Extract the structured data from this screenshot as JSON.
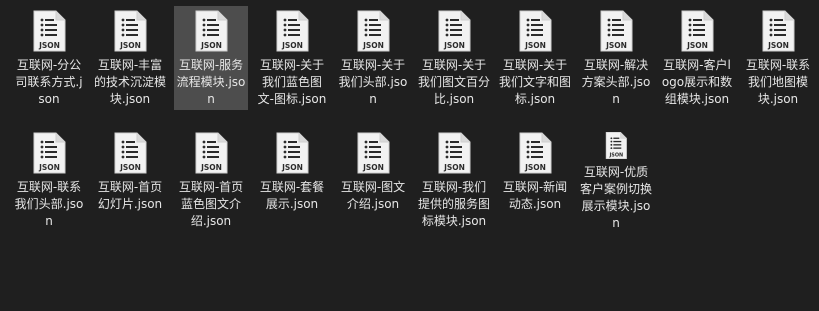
{
  "icon_badge": "JSON",
  "colors": {
    "background": "#1f1f1f",
    "selected": "#4d4d4d",
    "text": "#e6e6e6",
    "icon_body": "#f2f2f2",
    "icon_lines": "#2b2b2b"
  },
  "files": [
    {
      "name": "互联网-分公司联系方式.json",
      "selected": false
    },
    {
      "name": "互联网-丰富的技术沉淀模块.json",
      "selected": false
    },
    {
      "name": "互联网-服务流程模块.json",
      "selected": true
    },
    {
      "name": "互联网-关于我们蓝色图文-图标.json",
      "selected": false
    },
    {
      "name": "互联网-关于我们头部.json",
      "selected": false
    },
    {
      "name": "互联网-关于我们图文百分比.json",
      "selected": false
    },
    {
      "name": "互联网-关于我们文字和图标.json",
      "selected": false
    },
    {
      "name": "互联网-解决方案头部.json",
      "selected": false
    },
    {
      "name": "互联网-客户logo展示和数组模块.json",
      "selected": false
    },
    {
      "name": "互联网-联系我们地图模块.json",
      "selected": false
    },
    {
      "name": "互联网-联系我们头部.json",
      "selected": false
    },
    {
      "name": "互联网-首页幻灯片.json",
      "selected": false
    },
    {
      "name": "互联网-首页蓝色图文介绍.json",
      "selected": false
    },
    {
      "name": "互联网-套餐展示.json",
      "selected": false
    },
    {
      "name": "互联网-图文介绍.json",
      "selected": false
    },
    {
      "name": "互联网-我们提供的服务图标模块.json",
      "selected": false
    },
    {
      "name": "互联网-新闻动态.json",
      "selected": false
    },
    {
      "name": "互联网-优质客户案例切换展示模块.json",
      "selected": false
    }
  ]
}
